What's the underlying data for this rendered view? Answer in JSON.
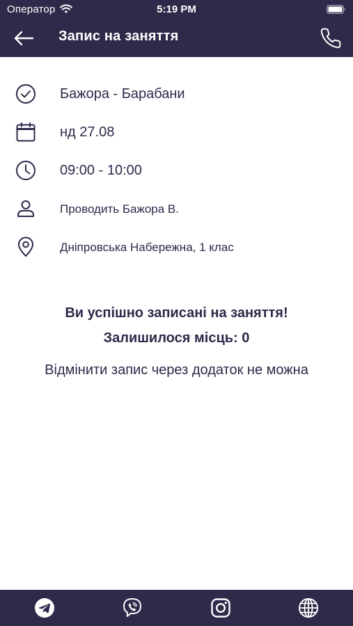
{
  "status_bar": {
    "carrier": "Оператор",
    "time": "5:19 PM"
  },
  "nav": {
    "title": "Запис на заняття",
    "back_icon": "arrow-left-icon",
    "phone_icon": "phone-icon"
  },
  "details": {
    "lesson": "Бажора - Барабани",
    "date": "нд 27.08",
    "time_range": "09:00 - 10:00",
    "teacher": "Проводить Бажора В.",
    "location": "Дніпровська Набережна, 1 клас"
  },
  "messages": {
    "success": "Ви успішно записані на заняття!",
    "seats_left": "Залишилося місць: 0",
    "cancel_note": "Відмінити запис через додаток не можна"
  },
  "social": {
    "icons": [
      "telegram-icon",
      "viber-icon",
      "instagram-icon",
      "globe-icon"
    ]
  },
  "colors": {
    "header_bg": "#2e2b4a",
    "text": "#2b2a49",
    "background": "#ffffff"
  }
}
